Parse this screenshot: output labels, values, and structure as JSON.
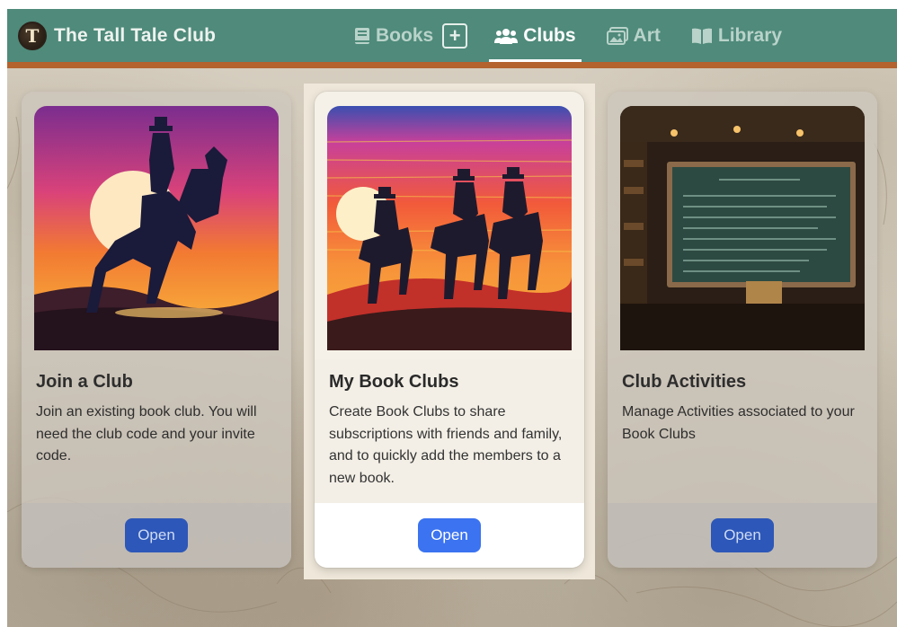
{
  "app": {
    "title": "The Tall Tale Club",
    "logo_letter": "T"
  },
  "nav": {
    "items": [
      {
        "label": "Books",
        "icon": "book-icon",
        "active": false
      },
      {
        "label": "+",
        "icon": "plus-square-icon",
        "active": false
      },
      {
        "label": "Clubs",
        "icon": "users-icon",
        "active": true
      },
      {
        "label": "Art",
        "icon": "images-icon",
        "active": false
      },
      {
        "label": "Library",
        "icon": "book-open-icon",
        "active": false
      }
    ]
  },
  "cards": [
    {
      "title": "Join a Club",
      "description": "Join an existing book club. You will need the club code and your invite code.",
      "button": "Open",
      "image": "cowboy-on-rearing-horse-at-sunset",
      "highlighted": false
    },
    {
      "title": "My Book Clubs",
      "description": "Create Book Clubs to share subscriptions with friends and family, and to quickly add the members to a new book.",
      "button": "Open",
      "image": "three-riders-at-sunset",
      "highlighted": true
    },
    {
      "title": "Club Activities",
      "description": "Manage Activities associated to your Book Clubs",
      "button": "Open",
      "image": "chalkboard-in-saloon",
      "highlighted": false
    }
  ],
  "colors": {
    "header": "#4f8a7a",
    "header_border": "#b4622e",
    "button": "#3b73f0"
  }
}
